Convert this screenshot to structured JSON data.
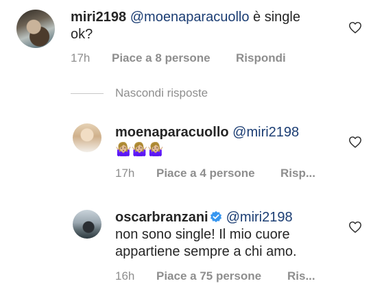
{
  "comments": [
    {
      "username": "miri2198",
      "mention": "@moenaparacuollo",
      "text_line1": " è single",
      "text_line2": "ok?",
      "time": "17h",
      "likes": "Piace a 8 persone",
      "reply": "Rispondi"
    }
  ],
  "hide_replies_label": "Nascondi risposte",
  "replies": [
    {
      "username": "moenaparacuollo",
      "mention": "@miri2198",
      "text": "🤷🏼‍♀️🤷🏼‍♀️🤷🏼‍♀️",
      "time": "17h",
      "likes": "Piace a 4 persone",
      "reply": "Risp..."
    },
    {
      "username": "oscarbranzani",
      "mention": "@miri2198",
      "text_line1": "non sono single! Il mio cuore",
      "text_line2": "appartiene sempre a chi amo.",
      "time": "16h",
      "likes": "Piace a 75 persone",
      "reply": "Ris..."
    }
  ],
  "icons": {
    "avatar": "avatar",
    "like": "heart-outline-icon",
    "verified": "verified-badge-icon"
  },
  "colors": {
    "mention": "#1b3d73",
    "meta": "#8e8e8e",
    "verified": "#3897f0"
  }
}
